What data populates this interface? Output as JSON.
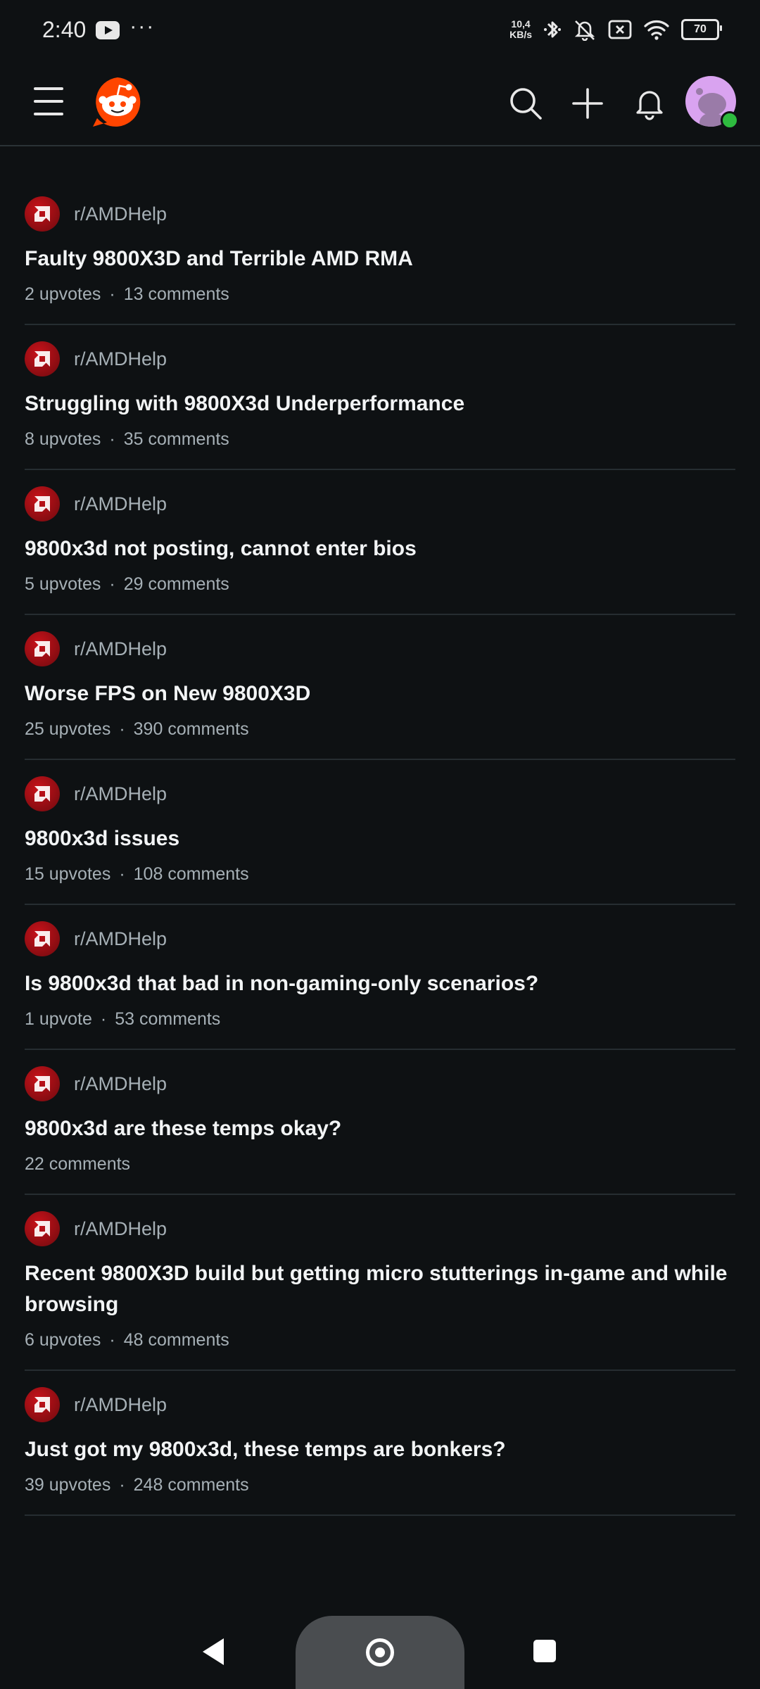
{
  "status_bar": {
    "time": "2:40",
    "dots": "···",
    "net_speed_value": "10,4",
    "net_speed_unit": "KB/s",
    "battery": "70"
  },
  "header": {
    "icons": [
      "menu-icon",
      "reddit-logo",
      "search-icon",
      "plus-icon",
      "bell-icon",
      "avatar"
    ],
    "accent_color": "#ff4500"
  },
  "posts": [
    {
      "subreddit": "r/AMDHelp",
      "title": "Faulty 9800X3D and Terrible AMD RMA",
      "upvotes": "2 upvotes",
      "comments": "13 comments"
    },
    {
      "subreddit": "r/AMDHelp",
      "title": "Struggling with 9800X3d Underperformance",
      "upvotes": "8 upvotes",
      "comments": "35 comments"
    },
    {
      "subreddit": "r/AMDHelp",
      "title": "9800x3d not posting, cannot enter bios",
      "upvotes": "5 upvotes",
      "comments": "29 comments"
    },
    {
      "subreddit": "r/AMDHelp",
      "title": "Worse FPS on New 9800X3D",
      "upvotes": "25 upvotes",
      "comments": "390 comments"
    },
    {
      "subreddit": "r/AMDHelp",
      "title": "9800x3d issues",
      "upvotes": "15 upvotes",
      "comments": "108 comments"
    },
    {
      "subreddit": "r/AMDHelp",
      "title": "Is 9800x3d that bad in non-gaming-only scenarios?",
      "upvotes": "1 upvote",
      "comments": "53 comments"
    },
    {
      "subreddit": "r/AMDHelp",
      "title": "9800x3d are these temps okay?",
      "upvotes": "",
      "comments": "22 comments"
    },
    {
      "subreddit": "r/AMDHelp",
      "title": "Recent 9800X3D build but getting micro stutterings in-game and while browsing",
      "upvotes": "6 upvotes",
      "comments": "48 comments"
    },
    {
      "subreddit": "r/AMDHelp",
      "title": "Just got my 9800x3d, these temps are bonkers?",
      "upvotes": "39 upvotes",
      "comments": "248 comments"
    }
  ]
}
